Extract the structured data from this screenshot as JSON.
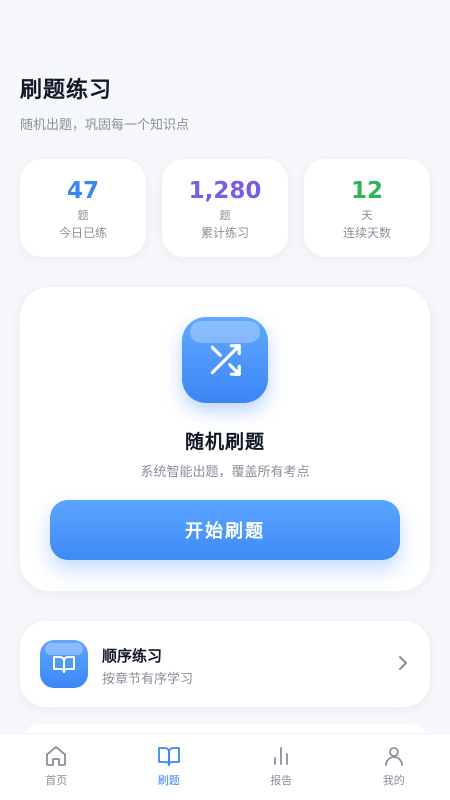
{
  "header": {
    "title": "刷题练习",
    "subtitle": "随机出题，巩固每一个知识点"
  },
  "stats": [
    {
      "value": "47",
      "unit": "题",
      "label": "今日已练",
      "color": "#3b86f5"
    },
    {
      "value": "1,280",
      "unit": "题",
      "label": "累计练习",
      "color": "#7b5ce6"
    },
    {
      "value": "12",
      "unit": "天",
      "label": "连续天数",
      "color": "#2fb45a"
    }
  ],
  "main_card": {
    "icon": "shuffle-icon",
    "title": "随机刷题",
    "description": "系统智能出题，覆盖所有考点",
    "button_label": "开始刷题"
  },
  "mode_card": {
    "icon": "book-icon",
    "title": "顺序练习",
    "description": "按章节有序学习"
  },
  "tabbar": {
    "active_color": "#3b86f5",
    "inactive_color": "#8a8f99",
    "items": [
      {
        "label": "首页",
        "icon": "home-icon"
      },
      {
        "label": "刷题",
        "icon": "book-icon",
        "active": true
      },
      {
        "label": "报告",
        "icon": "bar-chart-icon"
      },
      {
        "label": "我的",
        "icon": "user-icon"
      }
    ]
  }
}
